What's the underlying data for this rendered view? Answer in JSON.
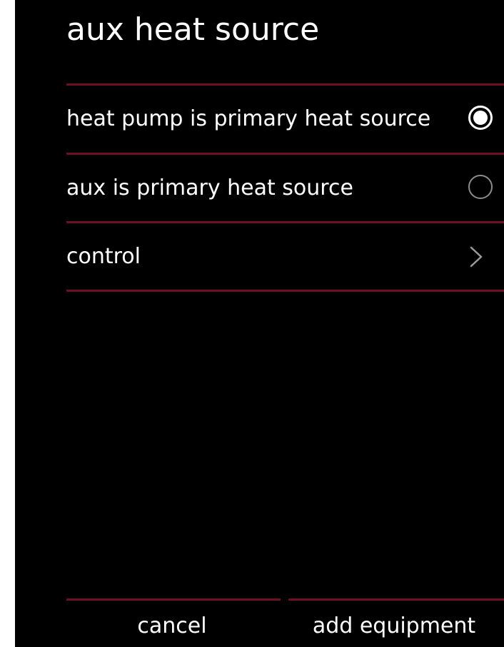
{
  "header": {
    "title": "aux heat source"
  },
  "options": [
    {
      "label": "heat pump is primary heat source",
      "selected": true,
      "control": "radio"
    },
    {
      "label": "aux is primary heat source",
      "selected": false,
      "control": "radio"
    },
    {
      "label": "control",
      "control": "chevron-right-icon"
    }
  ],
  "footer": {
    "cancel_label": "cancel",
    "add_label": "add equipment"
  },
  "colors": {
    "background": "#000000",
    "divider": "#6e1022",
    "text": "#ffffff",
    "radio_unselected": "#8c8c8c"
  }
}
